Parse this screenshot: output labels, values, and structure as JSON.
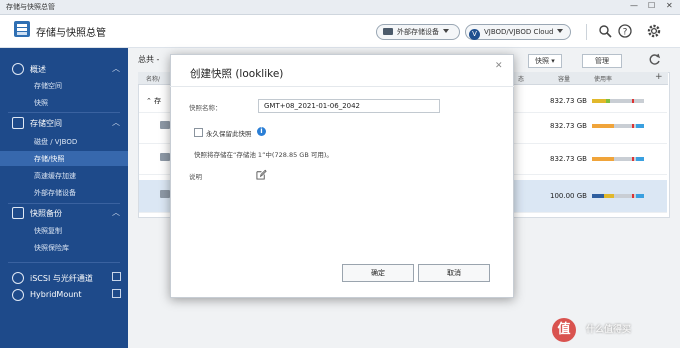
{
  "window": {
    "title": "存储与快照总管",
    "controls": {
      "minimize": "—",
      "maximize": "☐",
      "close": "✕"
    }
  },
  "header": {
    "app_title": "存储与快照总管",
    "external_device_label": "外部存储设备",
    "vjbod_label": "VJBOD/VJBOD Cloud",
    "icons": [
      "search-icon",
      "help-icon",
      "settings-icon"
    ]
  },
  "sidebar": {
    "sections": [
      {
        "label": "概述",
        "items": [
          "存储空间",
          "快照"
        ]
      },
      {
        "label": "存储空间",
        "items": [
          "磁盘 / VJBOD",
          "存储/快照",
          "高速缓存加速",
          "外部存储设备"
        ]
      },
      {
        "label": "快照备份",
        "items": [
          "快照复制",
          "快照保险库"
        ]
      }
    ],
    "links": [
      "iSCSI 与光纤通道",
      "HybridMount"
    ],
    "active_item": "存储/快照"
  },
  "main": {
    "total_label": "总共 -",
    "buttons": {
      "snapshot": "快照",
      "manage": "管理"
    },
    "columns": {
      "name": "名称/",
      "status": "态",
      "capacity": "容量",
      "usage": "使用率"
    },
    "group_label": "存",
    "rows": [
      {
        "capacity": "832.73 GB"
      },
      {
        "capacity": "832.73 GB"
      },
      {
        "capacity": "832.73 GB"
      },
      {
        "capacity": "100.00 GB"
      }
    ]
  },
  "dialog": {
    "title": "创建快照 (looklike)",
    "name_label": "快照名称：",
    "name_value": "GMT+08_2021-01-06_2042",
    "keep_label": "永久保留此快照",
    "info_icon": "i",
    "note": "快照将存储在“存储池 1”中(728.85 GB 可用)。",
    "desc_label": "说明",
    "ok_label": "确定",
    "cancel_label": "取消",
    "close_label": "✕"
  },
  "watermark": {
    "logo": "值",
    "text": "什么值得买"
  }
}
